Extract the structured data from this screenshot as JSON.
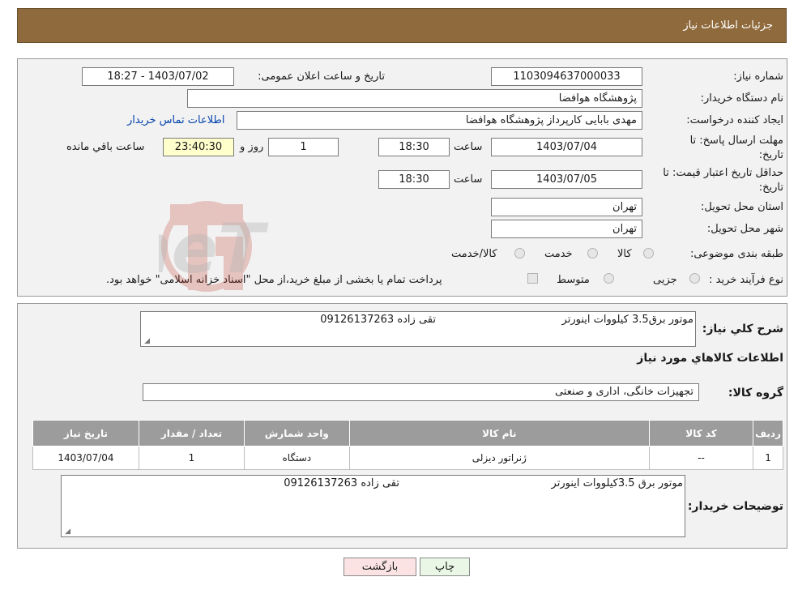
{
  "header": {
    "title": "جزئیات اطلاعات نیاز"
  },
  "fields": {
    "need_number_label": "شماره نیاز:",
    "need_number": "1103094637000033",
    "announce_label": "تاریخ و ساعت اعلان عمومی:",
    "announce_value": "1403/07/02 - 18:27",
    "buyer_org_label": "نام دستگاه خریدار:",
    "buyer_org": "پژوهشگاه هوافضا",
    "creator_label": "ایجاد کننده درخواست:",
    "creator": "مهدی بابایی کارپرداز پژوهشگاه هوافضا",
    "contact_link": "اطلاعات تماس خریدار",
    "deadline_label_1": "مهلت ارسال پاسخ: تا",
    "deadline_label_2": "تاریخ:",
    "deadline_date": "1403/07/04",
    "time_label": "ساعت",
    "deadline_time": "18:30",
    "days_value": "1",
    "days_label": "روز و",
    "remaining_time": "23:40:30",
    "remaining_label": "ساعت باقي مانده",
    "validity_label_1": "حداقل تاریخ اعتبار قیمت: تا",
    "validity_label_2": "تاریخ:",
    "validity_date": "1403/07/05",
    "validity_time": "18:30",
    "province_label": "استان محل تحویل:",
    "province": "تهران",
    "city_label": "شهر محل تحویل:",
    "city": "تهران",
    "category_label": "طبقه بندی موضوعی:",
    "category_options": [
      "کالا",
      "خدمت",
      "کالا/خدمت"
    ],
    "purchase_type_label": "نوع فرآیند خرید :",
    "purchase_options": [
      "جزیی",
      "متوسط"
    ],
    "purchase_note": "پرداخت تمام یا بخشی از مبلغ خرید،از محل \"اسناد خزانه اسلامی\" خواهد بود."
  },
  "summary": {
    "label": "شرح کلي نياز:",
    "text_main": "موتور برق3.5 کیلووات اینورتر",
    "text_contact": "تقی زاده 09126137263"
  },
  "goods": {
    "section_title": "اطلاعات کالاهاي مورد نياز",
    "group_label": "گروه کالا:",
    "group_value": "تجهیزات خانگی، اداری و صنعتی",
    "columns": [
      "ردیف",
      "کد کالا",
      "نام کالا",
      "واحد شمارش",
      "تعداد / مقدار",
      "تاریخ نیاز"
    ],
    "rows": [
      [
        "1",
        "--",
        "ژنراتور دیزلی",
        "دستگاه",
        "1",
        "1403/07/04"
      ]
    ]
  },
  "buyer_notes": {
    "label": "توضیحات خریدار:",
    "text_main": "موتور برق 3.5کیلووات اینورتر",
    "text_contact": "تقی زاده 09126137263"
  },
  "buttons": {
    "print": "چاپ",
    "back": "بازگشت"
  },
  "watermark": {
    "text": "AriaTender.neT"
  },
  "colors": {
    "header_bg": "#8f6a3c",
    "table_header_bg": "#9c9c9c",
    "back_button_bg": "#fbe3e3"
  }
}
